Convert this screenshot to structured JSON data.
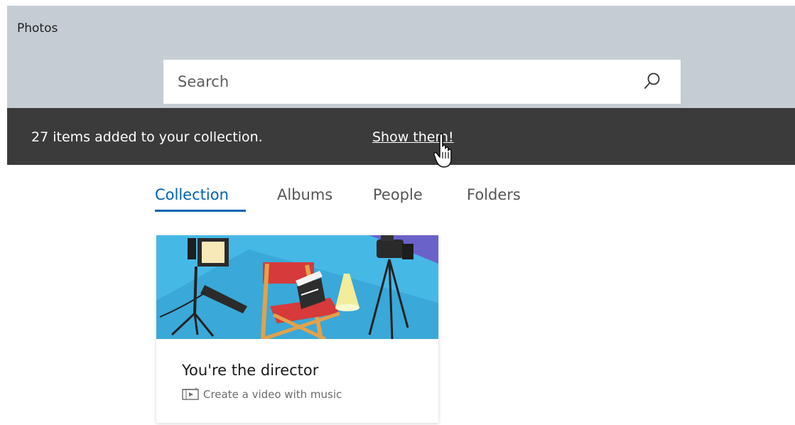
{
  "app": {
    "title": "Photos"
  },
  "search": {
    "placeholder": "Search",
    "icon": "search-icon"
  },
  "notification": {
    "message": "27 items added to your collection.",
    "link": "Show them!"
  },
  "tabs": [
    {
      "label": "Collection",
      "active": true
    },
    {
      "label": "Albums",
      "active": false
    },
    {
      "label": "People",
      "active": false
    },
    {
      "label": "Folders",
      "active": false
    }
  ],
  "card": {
    "title": "You're the director",
    "subtitle": "Create a video with music",
    "icon": "video-icon"
  },
  "colors": {
    "topbar": "#c5ccd4",
    "notification_bg": "#3b3b3b",
    "accent": "#0063b1",
    "card_illustration_bg": "#46b8e6"
  }
}
